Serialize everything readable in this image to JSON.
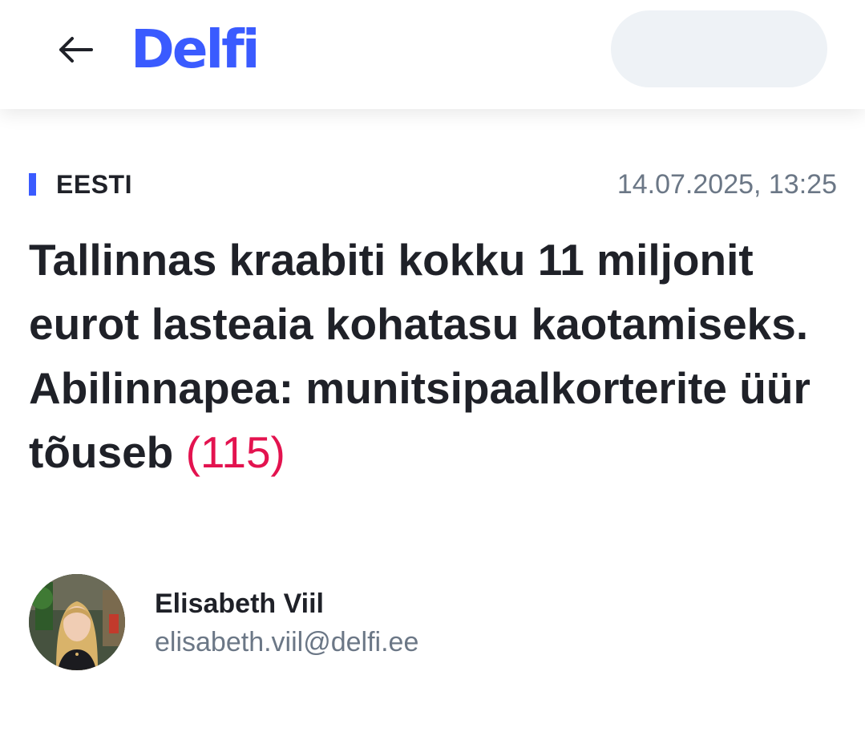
{
  "header": {
    "logo_text": "Delfi",
    "back_icon": "arrow-left-icon",
    "accent_color": "#3a5bff"
  },
  "article": {
    "category": "EESTI",
    "date": "14.07.2025, 13:25",
    "title": "Tallinnas kraabiti kokku 11 miljonit eurot lasteaia kohatasu kaotamiseks. Abilinnapea: munitsipaalkorterite üür tõuseb",
    "comment_count": "(115)",
    "comment_color": "#e3134f"
  },
  "author": {
    "name": "Elisabeth Viil",
    "email": "elisabeth.viil@delfi.ee"
  }
}
